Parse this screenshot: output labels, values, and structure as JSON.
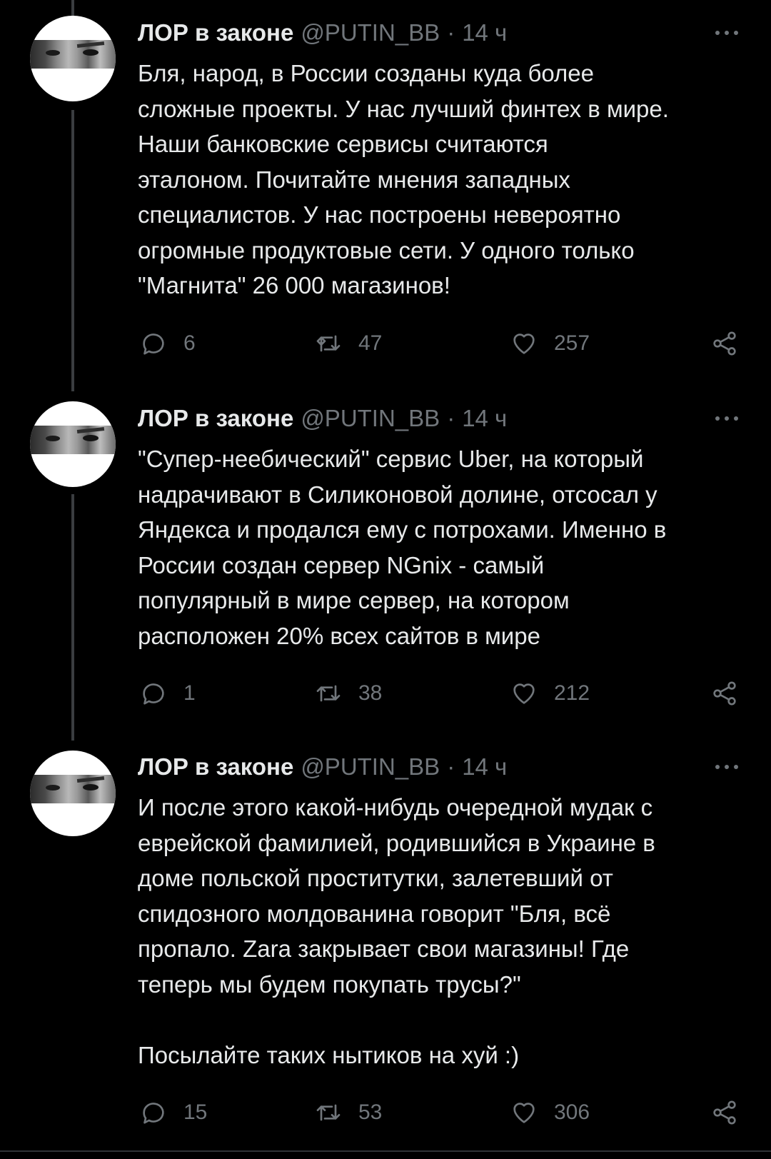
{
  "tweets": [
    {
      "author_name": "ЛОР в законе",
      "handle": "@PUTIN_BB",
      "separator": "·",
      "time": "14 ч",
      "text": "Бля, народ, в России созданы куда более\nсложные проекты. У нас лучший финтех в мире.\nНаши банковские сервисы считаются\nэталоном. Почитайте мнения западных\nспециалистов. У нас построены невероятно\nогромные продуктовые сети. У одного только\n\"Магнита\" 26 000 магазинов!",
      "replies": "6",
      "retweets": "47",
      "likes": "257"
    },
    {
      "author_name": "ЛОР в законе",
      "handle": "@PUTIN_BB",
      "separator": "·",
      "time": "14 ч",
      "text": "\"Супер-неебический\" сервис Uber, на который\nнадрачивают в Силиконовой долине, отсосал у\nЯндекса и продался ему с потрохами. Именно в\nРоссии создан сервер NGnix - самый\nпопулярный в мире сервер, на котором\nрасположен 20% всех сайтов в мире",
      "replies": "1",
      "retweets": "38",
      "likes": "212"
    },
    {
      "author_name": "ЛОР в законе",
      "handle": "@PUTIN_BB",
      "separator": "·",
      "time": "14 ч",
      "text": "И после этого какой-нибудь очередной мудак с\nеврейской фамилией, родившийся в Украине в\nдоме польской проститутки, залетевший от\nспидозного молдованина говорит \"Бля, всё\nпропало. Zara закрывает свои магазины! Где\nтеперь мы будем покупать трусы?\"\n\nПосылайте таких нытиков на хуй :)",
      "replies": "15",
      "retweets": "53",
      "likes": "306"
    }
  ],
  "icons": {
    "reply": "speech-bubble-icon",
    "retweet": "retweet-arrows-icon",
    "like": "heart-icon",
    "share": "share-nodes-icon",
    "more": "more-dots-icon"
  },
  "colors": {
    "background": "#000000",
    "text": "#e7e9ea",
    "muted": "#71767b",
    "thread_line": "#3a3d40"
  }
}
